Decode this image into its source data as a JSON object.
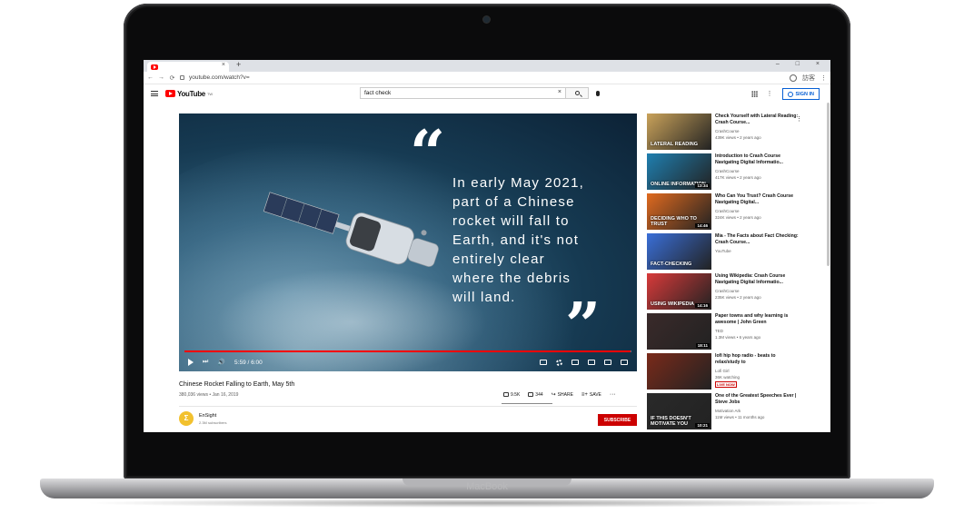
{
  "device": {
    "brand": "MacBook"
  },
  "browser": {
    "tab_close": "×",
    "new_tab": "+",
    "window_controls": "–  □  ×",
    "url": "youtube.com/watch?v=",
    "nav": {
      "back": "←",
      "forward": "→",
      "reload": "⟳"
    },
    "profile_label": "訪客"
  },
  "header": {
    "logo_text": "YouTube",
    "logo_sup": "TW",
    "search_value": "fact check",
    "clear": "×",
    "signin_label": "SIGN IN",
    "dots": "⋮"
  },
  "player": {
    "quote_open": "“",
    "quote_close": "”",
    "quote_lines": [
      "In early May 2021,",
      "part of a Chinese",
      "rocket will fall to",
      "Earth, and it's not",
      "entirely clear",
      "where the debris",
      "will land."
    ],
    "time": "5:59 / 6:00",
    "progress": 0.997,
    "cc": "CC"
  },
  "video": {
    "title": "Chinese Rocket Falling to Earth, May 5th",
    "meta": "380,036 views • Jan 16, 2019",
    "likes": "9.5K",
    "dislikes": "344",
    "share": "SHARE",
    "save": "SAVE",
    "more": "···"
  },
  "channel": {
    "avatar_letter": "Σ",
    "name": "EnSight",
    "subs": "2.3M subscribers",
    "subscribe_label": "SUBSCRIBE"
  },
  "recommendations": [
    {
      "title": "Check Yourself with Lateral Reading: Crash Course...",
      "channel": "CrashCourse",
      "views": "439K views • 2 years ago",
      "overlay": "LATERAL READING",
      "duration": "",
      "color": "#c9a25a"
    },
    {
      "title": "Introduction to Crash Course Navigating Digital Informatio...",
      "channel": "CrashCourse",
      "views": "417K views • 2 years ago",
      "overlay": "ONLINE INFORMATION",
      "duration": "13:34",
      "color": "#1f7fb0"
    },
    {
      "title": "Who Can You Trust? Crash Course Navigating Digital...",
      "channel": "CrashCourse",
      "views": "324K views • 2 years ago",
      "overlay": "DECIDING WHO TO TRUST",
      "duration": "14:46",
      "color": "#e06a1f"
    },
    {
      "title": "Mia - The Facts about Fact Checking: Crash Course...",
      "channel": "YouTube",
      "views": "",
      "overlay": "FACT-CHECKING",
      "duration": "",
      "color": "#3a6fd8"
    },
    {
      "title": "Using Wikipedia: Crash Course Navigating Digital Informatio...",
      "channel": "CrashCourse",
      "views": "235K views • 2 years ago",
      "overlay": "USING WIKIPEDIA",
      "duration": "14:16",
      "color": "#d83a3a"
    },
    {
      "title": "Paper towns and why learning is awesome | John Green",
      "channel": "TED",
      "views": "1.3M views • 6 years ago",
      "overlay": "",
      "duration": "18:11",
      "color": "#3a2a2a"
    },
    {
      "title": "lofi hip hop radio - beats to relax/study to",
      "channel": "Lofi Girl",
      "views": "36K watching",
      "overlay": "",
      "duration": "",
      "live": "LIVE NOW",
      "color": "#7a2a1a"
    },
    {
      "title": "One of the Greatest Speeches Ever | Steve Jobs",
      "channel": "Motivation Ark",
      "views": "11M views • 11 months ago",
      "overlay": "IF THIS DOESN'T MOTIVATE YOU",
      "duration": "10:21",
      "color": "#2a2a2a"
    }
  ],
  "reco_more": "⋮"
}
